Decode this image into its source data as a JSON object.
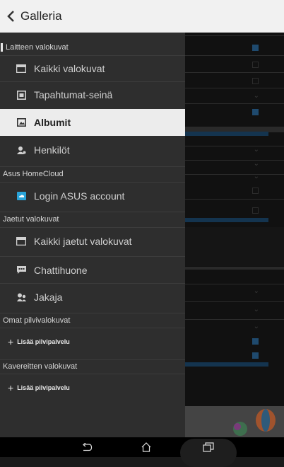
{
  "header": {
    "title": "Galleria"
  },
  "drawer": {
    "sections": {
      "device": "Laitteen valokuvat",
      "cloud": "Asus HomeCloud",
      "shared": "Jaetut valokuvat",
      "own_cloud": "Omat pilvivalokuvat",
      "friends": "Kavereitten valokuvat"
    },
    "items": {
      "all_photos": "Kaikki valokuvat",
      "events_wall": "Tapahtumat-seinä",
      "albums": "Albumit",
      "people": "Henkilöt",
      "login_asus": "Login ASUS account",
      "all_shared": "Kaikki jaetut valokuvat",
      "chatroom": "Chattihuone",
      "sharer": "Jakaja",
      "add_cloud_1": "Lisää pilvipalvelu",
      "add_cloud_2": "Lisää pilvipalvelu"
    },
    "selected_item": "Albumit"
  },
  "colors": {
    "accent": "#29a3d8",
    "drawer_bg": "#2e2e2e",
    "selected_bg": "#ececec"
  },
  "icons": {
    "back": "chevron-left-icon",
    "all_photos": "photo-stack-icon",
    "events_wall": "calendar-photo-icon",
    "albums": "album-icon",
    "people": "people-icon",
    "login_asus": "cloud-icon",
    "all_shared": "shared-photos-icon",
    "chatroom": "chat-icon",
    "sharer": "sharer-icon",
    "plus": "plus-icon"
  },
  "nav": {
    "back": "back-icon",
    "home": "home-icon",
    "recent": "recent-apps-icon"
  }
}
